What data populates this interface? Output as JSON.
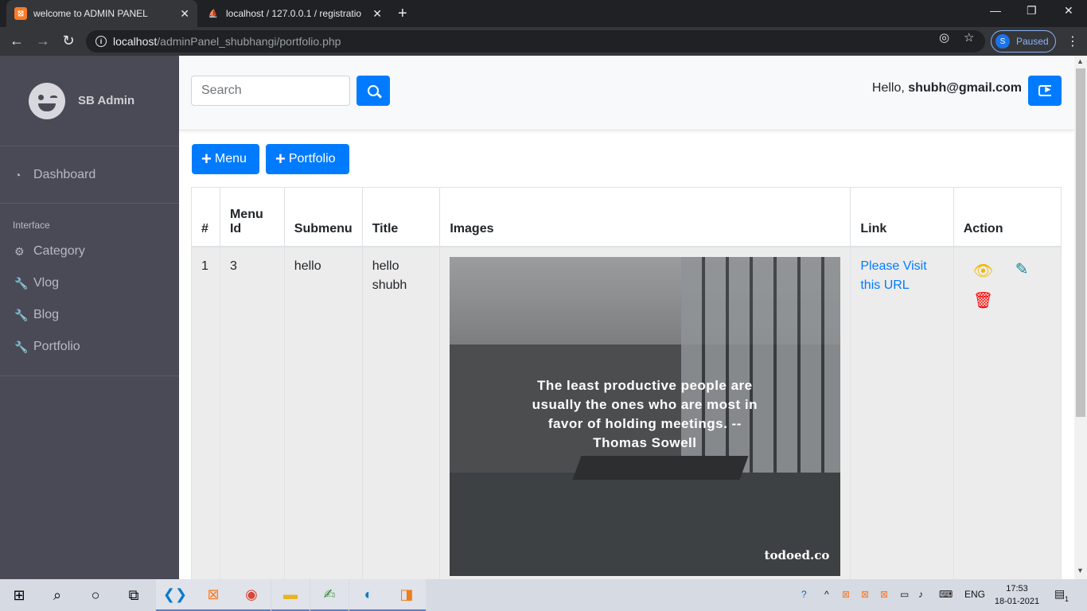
{
  "browser": {
    "tabs": [
      {
        "title": "welcome to ADMIN PANEL",
        "active": true
      },
      {
        "title": "localhost / 127.0.0.1 / registratio",
        "active": false
      }
    ],
    "url_host": "localhost",
    "url_path": "/adminPanel_shubhangi/portfolio.php",
    "profile_initial": "S",
    "profile_status": "Paused"
  },
  "sidebar": {
    "brand": "SB Admin",
    "dashboard": "Dashboard",
    "section_heading": "Interface",
    "items": [
      {
        "label": "Category",
        "icon": "gear-icon"
      },
      {
        "label": "Vlog",
        "icon": "wrench-icon"
      },
      {
        "label": "Blog",
        "icon": "wrench-icon"
      },
      {
        "label": "Portfolio",
        "icon": "wrench-icon"
      }
    ]
  },
  "topnav": {
    "search_placeholder": "Search",
    "hello_prefix": "Hello,",
    "user_email": "shubh@gmail.com"
  },
  "actions": {
    "add_menu": "Menu",
    "add_portfolio": "Portfolio"
  },
  "table": {
    "headers": [
      "#",
      "Menu Id",
      "Submenu",
      "Title",
      "Images",
      "Link",
      "Action"
    ],
    "rows": [
      {
        "num": "1",
        "menu_id": "3",
        "submenu": "hello",
        "title": "hello shubh",
        "image_quote": "The least productive people are usually the ones who are most in favor of holding meetings. -- Thomas Sowell",
        "image_watermark": "todoed.co",
        "link": "Please Visit this URL"
      }
    ]
  },
  "colors": {
    "primary": "#007bff",
    "view_icon": "#f0b800",
    "edit_icon": "#138496",
    "delete_icon": "#ff0000"
  },
  "taskbar": {
    "lang": "ENG",
    "time": "17:53",
    "date": "18-01-2021",
    "notifications": "1"
  }
}
